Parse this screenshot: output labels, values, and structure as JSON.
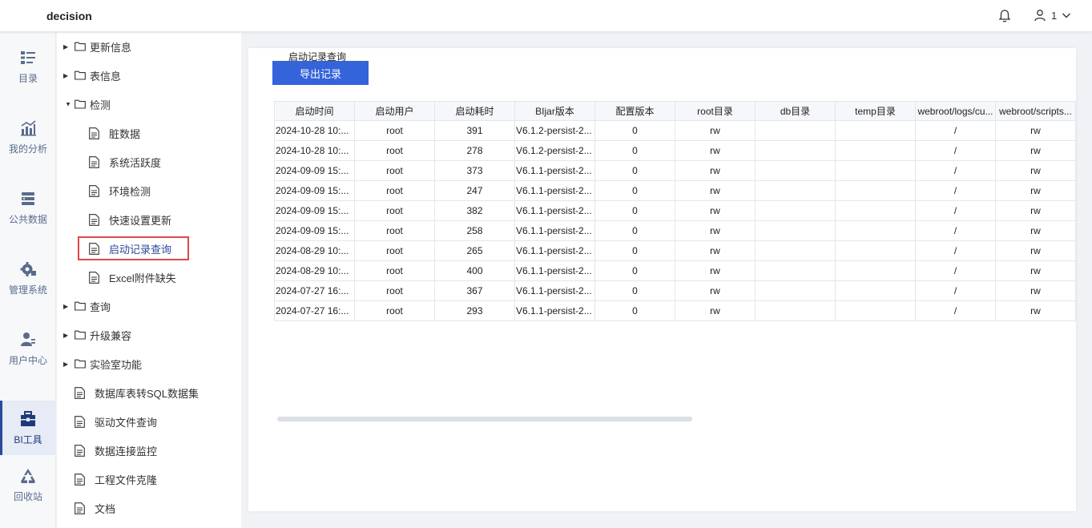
{
  "app": {
    "title": "decision",
    "user_label": "1"
  },
  "left_nav": [
    {
      "label": "目录",
      "icon": "list-icon"
    },
    {
      "label": "我的分析",
      "icon": "chart-icon"
    },
    {
      "label": "公共数据",
      "icon": "database-icon"
    },
    {
      "label": "管理系统",
      "icon": "gear-icon"
    },
    {
      "label": "用户中心",
      "icon": "user-icon"
    },
    {
      "label": "BI工具",
      "icon": "toolbox-icon",
      "active": true
    },
    {
      "label": "回收站",
      "icon": "recycle-icon"
    }
  ],
  "tree": [
    {
      "label": "更新信息",
      "type": "folder",
      "expanded": false
    },
    {
      "label": "表信息",
      "type": "folder",
      "expanded": false
    },
    {
      "label": "检测",
      "type": "folder",
      "expanded": true
    },
    {
      "label": "脏数据",
      "type": "file",
      "level": 1
    },
    {
      "label": "系统活跃度",
      "type": "file",
      "level": 1
    },
    {
      "label": "环境检测",
      "type": "file",
      "level": 1
    },
    {
      "label": "快速设置更新",
      "type": "file",
      "level": 1
    },
    {
      "label": "启动记录查询",
      "type": "file",
      "level": 1,
      "selected": true
    },
    {
      "label": "Excel附件缺失",
      "type": "file",
      "level": 1
    },
    {
      "label": "查询",
      "type": "folder",
      "expanded": false
    },
    {
      "label": "升级兼容",
      "type": "folder",
      "expanded": false
    },
    {
      "label": "实验室功能",
      "type": "folder",
      "expanded": false
    },
    {
      "label": "数据库表转SQL数据集",
      "type": "file",
      "level": 0
    },
    {
      "label": "驱动文件查询",
      "type": "file",
      "level": 0
    },
    {
      "label": "数据连接监控",
      "type": "file",
      "level": 0
    },
    {
      "label": "工程文件克隆",
      "type": "file",
      "level": 0
    },
    {
      "label": "文档",
      "type": "file",
      "level": 0
    }
  ],
  "panel": {
    "title": "启动记录查询",
    "export_label": "导出记录",
    "columns": [
      "启动时间",
      "启动用户",
      "启动耗时",
      "BIjar版本",
      "配置版本",
      "root目录",
      "db目录",
      "temp目录",
      "webroot/logs/cu...",
      "webroot/scripts..."
    ],
    "rows": [
      [
        "2024-10-28 10:...",
        "root",
        "391",
        "V6.1.2-persist-2...",
        "0",
        "rw",
        "",
        "",
        "/",
        "rw"
      ],
      [
        "2024-10-28 10:...",
        "root",
        "278",
        "V6.1.2-persist-2...",
        "0",
        "rw",
        "",
        "",
        "/",
        "rw"
      ],
      [
        "2024-09-09 15:...",
        "root",
        "373",
        "V6.1.1-persist-2...",
        "0",
        "rw",
        "",
        "",
        "/",
        "rw"
      ],
      [
        "2024-09-09 15:...",
        "root",
        "247",
        "V6.1.1-persist-2...",
        "0",
        "rw",
        "",
        "",
        "/",
        "rw"
      ],
      [
        "2024-09-09 15:...",
        "root",
        "382",
        "V6.1.1-persist-2...",
        "0",
        "rw",
        "",
        "",
        "/",
        "rw"
      ],
      [
        "2024-09-09 15:...",
        "root",
        "258",
        "V6.1.1-persist-2...",
        "0",
        "rw",
        "",
        "",
        "/",
        "rw"
      ],
      [
        "2024-08-29 10:...",
        "root",
        "265",
        "V6.1.1-persist-2...",
        "0",
        "rw",
        "",
        "",
        "/",
        "rw"
      ],
      [
        "2024-08-29 10:...",
        "root",
        "400",
        "V6.1.1-persist-2...",
        "0",
        "rw",
        "",
        "",
        "/",
        "rw"
      ],
      [
        "2024-07-27 16:...",
        "root",
        "367",
        "V6.1.1-persist-2...",
        "0",
        "rw",
        "",
        "",
        "/",
        "rw"
      ],
      [
        "2024-07-27 16:...",
        "root",
        "293",
        "V6.1.1-persist-2...",
        "0",
        "rw",
        "",
        "",
        "/",
        "rw"
      ]
    ]
  }
}
